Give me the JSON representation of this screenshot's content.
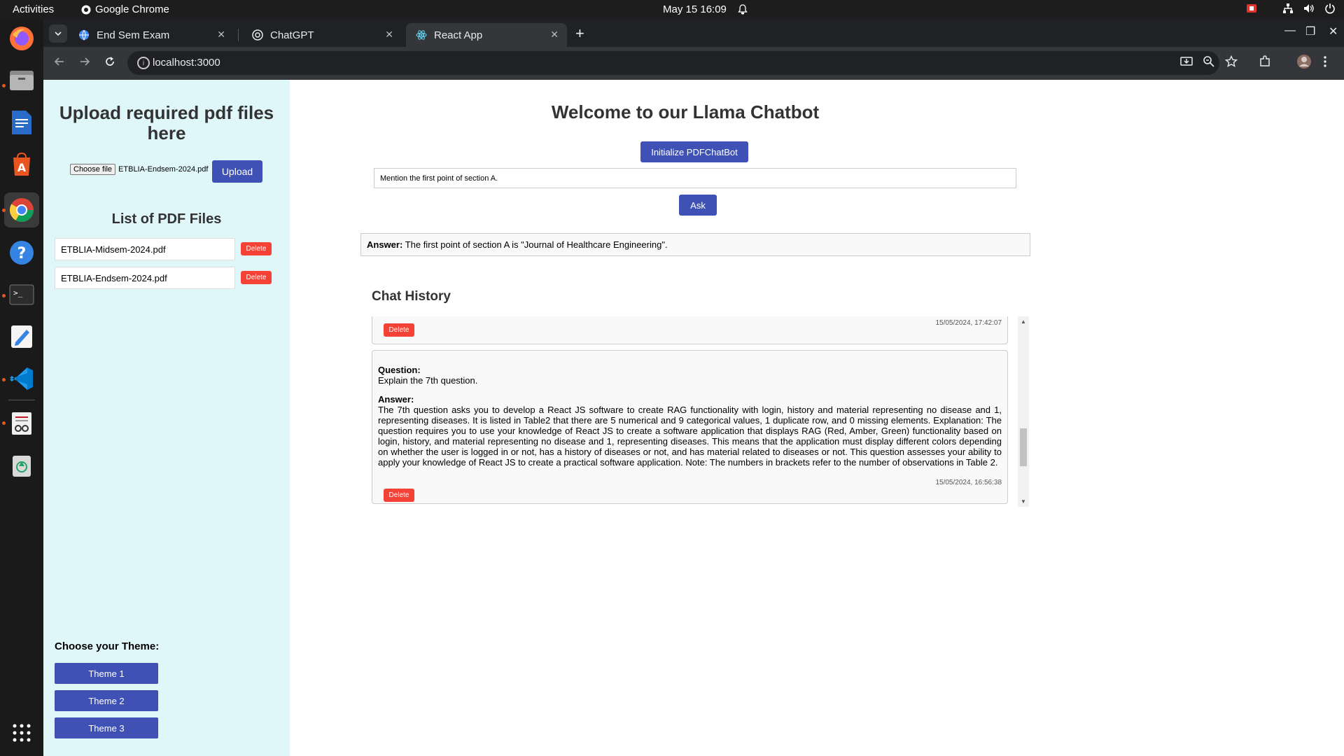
{
  "topbar": {
    "activities": "Activities",
    "app_name": "Google Chrome",
    "clock": "May 15  16:09"
  },
  "dock": {
    "items": [
      "firefox-icon",
      "files-icon",
      "writer-icon",
      "app-center-icon",
      "chrome-icon",
      "help-icon",
      "terminal-icon",
      "text-editor-icon",
      "vscode-icon",
      "document-viewer-icon",
      "trash-icon",
      "app-grid-icon"
    ]
  },
  "browser": {
    "tabs": [
      {
        "title": "End Sem Exam",
        "icon": "globe-icon"
      },
      {
        "title": "ChatGPT",
        "icon": "openai-icon"
      },
      {
        "title": "React App",
        "icon": "react-icon"
      }
    ],
    "url": "localhost:3000",
    "accent": "#3f51b5"
  },
  "sidebar": {
    "upload_title": "Upload required pdf files here",
    "choose_file_label": "Choose file",
    "chosen_file": "ETBLIA-Endsem-2024.pdf",
    "upload_label": "Upload",
    "list_title": "List of PDF Files",
    "pdf_files": [
      {
        "name": "ETBLIA-Midsem-2024.pdf",
        "delete_label": "Delete"
      },
      {
        "name": "ETBLIA-Endsem-2024.pdf",
        "delete_label": "Delete"
      }
    ],
    "theme_title": "Choose your Theme:",
    "themes": [
      "Theme 1",
      "Theme 2",
      "Theme 3"
    ],
    "background": "#e0f7fa"
  },
  "main": {
    "title": "Welcome to our Llama Chatbot",
    "init_label": "Initialize PDFChatBot",
    "question_value": "Mention the first point of section A.",
    "ask_label": "Ask",
    "answer_label": "Answer:",
    "answer_text": "The first point of section A is \"Journal of Healthcare Engineering\".",
    "history_title": "Chat History",
    "history": [
      {
        "timestamp": "15/05/2024, 17:42:07",
        "delete_label": "Delete"
      },
      {
        "question_label": "Question:",
        "question": "Explain the 7th question.",
        "answer_label": "Answer:",
        "answer": "The 7th question asks you to develop a React JS software to create RAG functionality with login, history and material representing no disease and 1, representing diseases. It is listed in Table2 that there are 5 numerical and 9 categorical values, 1 duplicate row, and 0 missing elements. Explanation: The question requires you to use your knowledge of React JS to create a software application that displays RAG (Red, Amber, Green) functionality based on login, history, and material representing no disease and 1, representing diseases. This means that the application must display different colors depending on whether the user is logged in or not, has a history of diseases or not, and has material related to diseases or not. This question assesses your ability to apply your knowledge of React JS to create a practical software application. Note: The numbers in brackets refer to the number of observations in Table 2.",
        "timestamp": "15/05/2024, 16:56:38",
        "delete_label": "Delete"
      }
    ]
  }
}
